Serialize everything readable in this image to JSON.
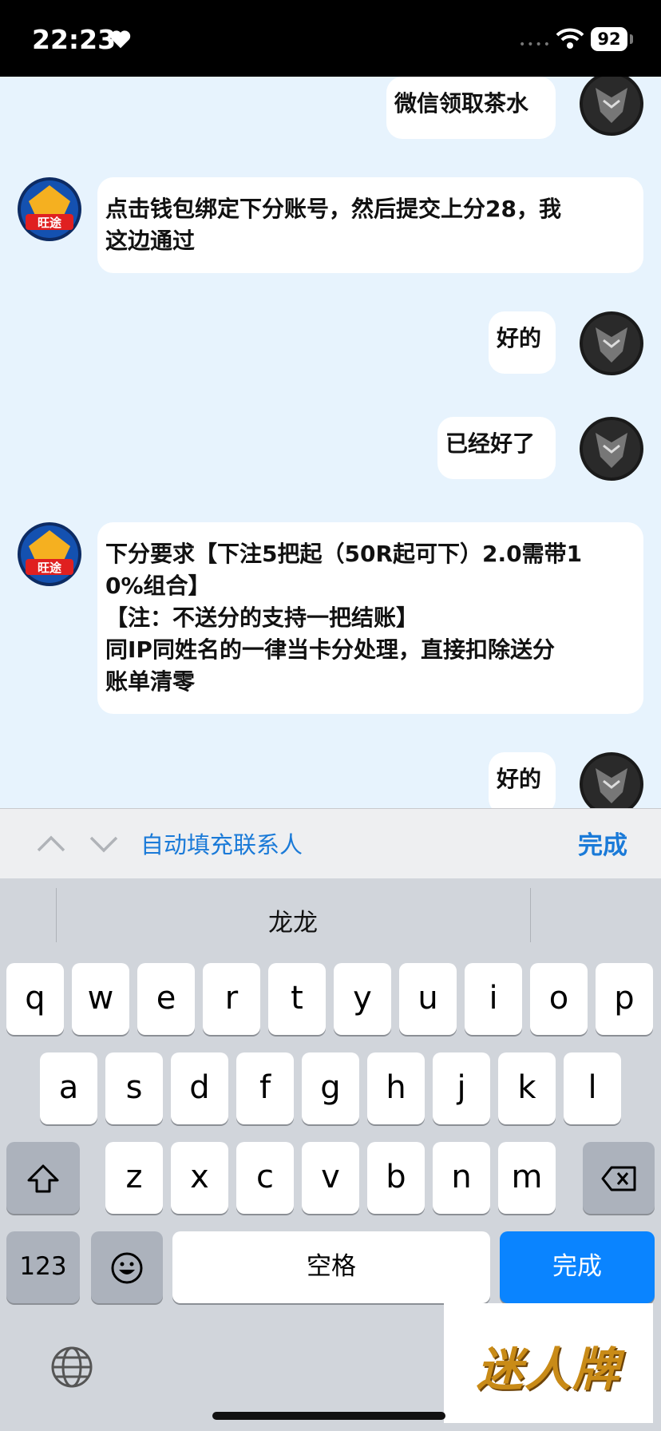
{
  "status_bar": {
    "time": "22:23",
    "battery": "92"
  },
  "chat": {
    "messages": [
      {
        "side": "right",
        "text": "微信领取茶水"
      },
      {
        "side": "left",
        "text": "点击钱包绑定下分账号，然后提交上分28，我\n这边通过"
      },
      {
        "side": "right",
        "text": "好的"
      },
      {
        "side": "right",
        "text": "已经好了"
      },
      {
        "side": "left",
        "text": "下分要求【下注5把起（50R起可下）2.0需带1\n0%组合】\n【注：不送分的支持一把结账】\n同IP同姓名的一律当卡分处理，直接扣除送分\n账单清零"
      },
      {
        "side": "right",
        "text": "好的"
      }
    ],
    "left_avatar_text": "旺途"
  },
  "accessory_bar": {
    "autofill": "自动填充联系人",
    "done": "完成"
  },
  "keyboard": {
    "candidate": "龙龙",
    "row1": [
      "q",
      "w",
      "e",
      "r",
      "t",
      "y",
      "u",
      "i",
      "o",
      "p"
    ],
    "row2": [
      "a",
      "s",
      "d",
      "f",
      "g",
      "h",
      "j",
      "k",
      "l"
    ],
    "row3": [
      "z",
      "x",
      "c",
      "v",
      "b",
      "n",
      "m"
    ],
    "num_key": "123",
    "space": "空格",
    "done": "完成"
  },
  "watermark": "迷人牌",
  "colors": {
    "chat_bg": "#e7f3fd",
    "accent": "#1a7ad8",
    "done_key": "#0a84ff"
  }
}
